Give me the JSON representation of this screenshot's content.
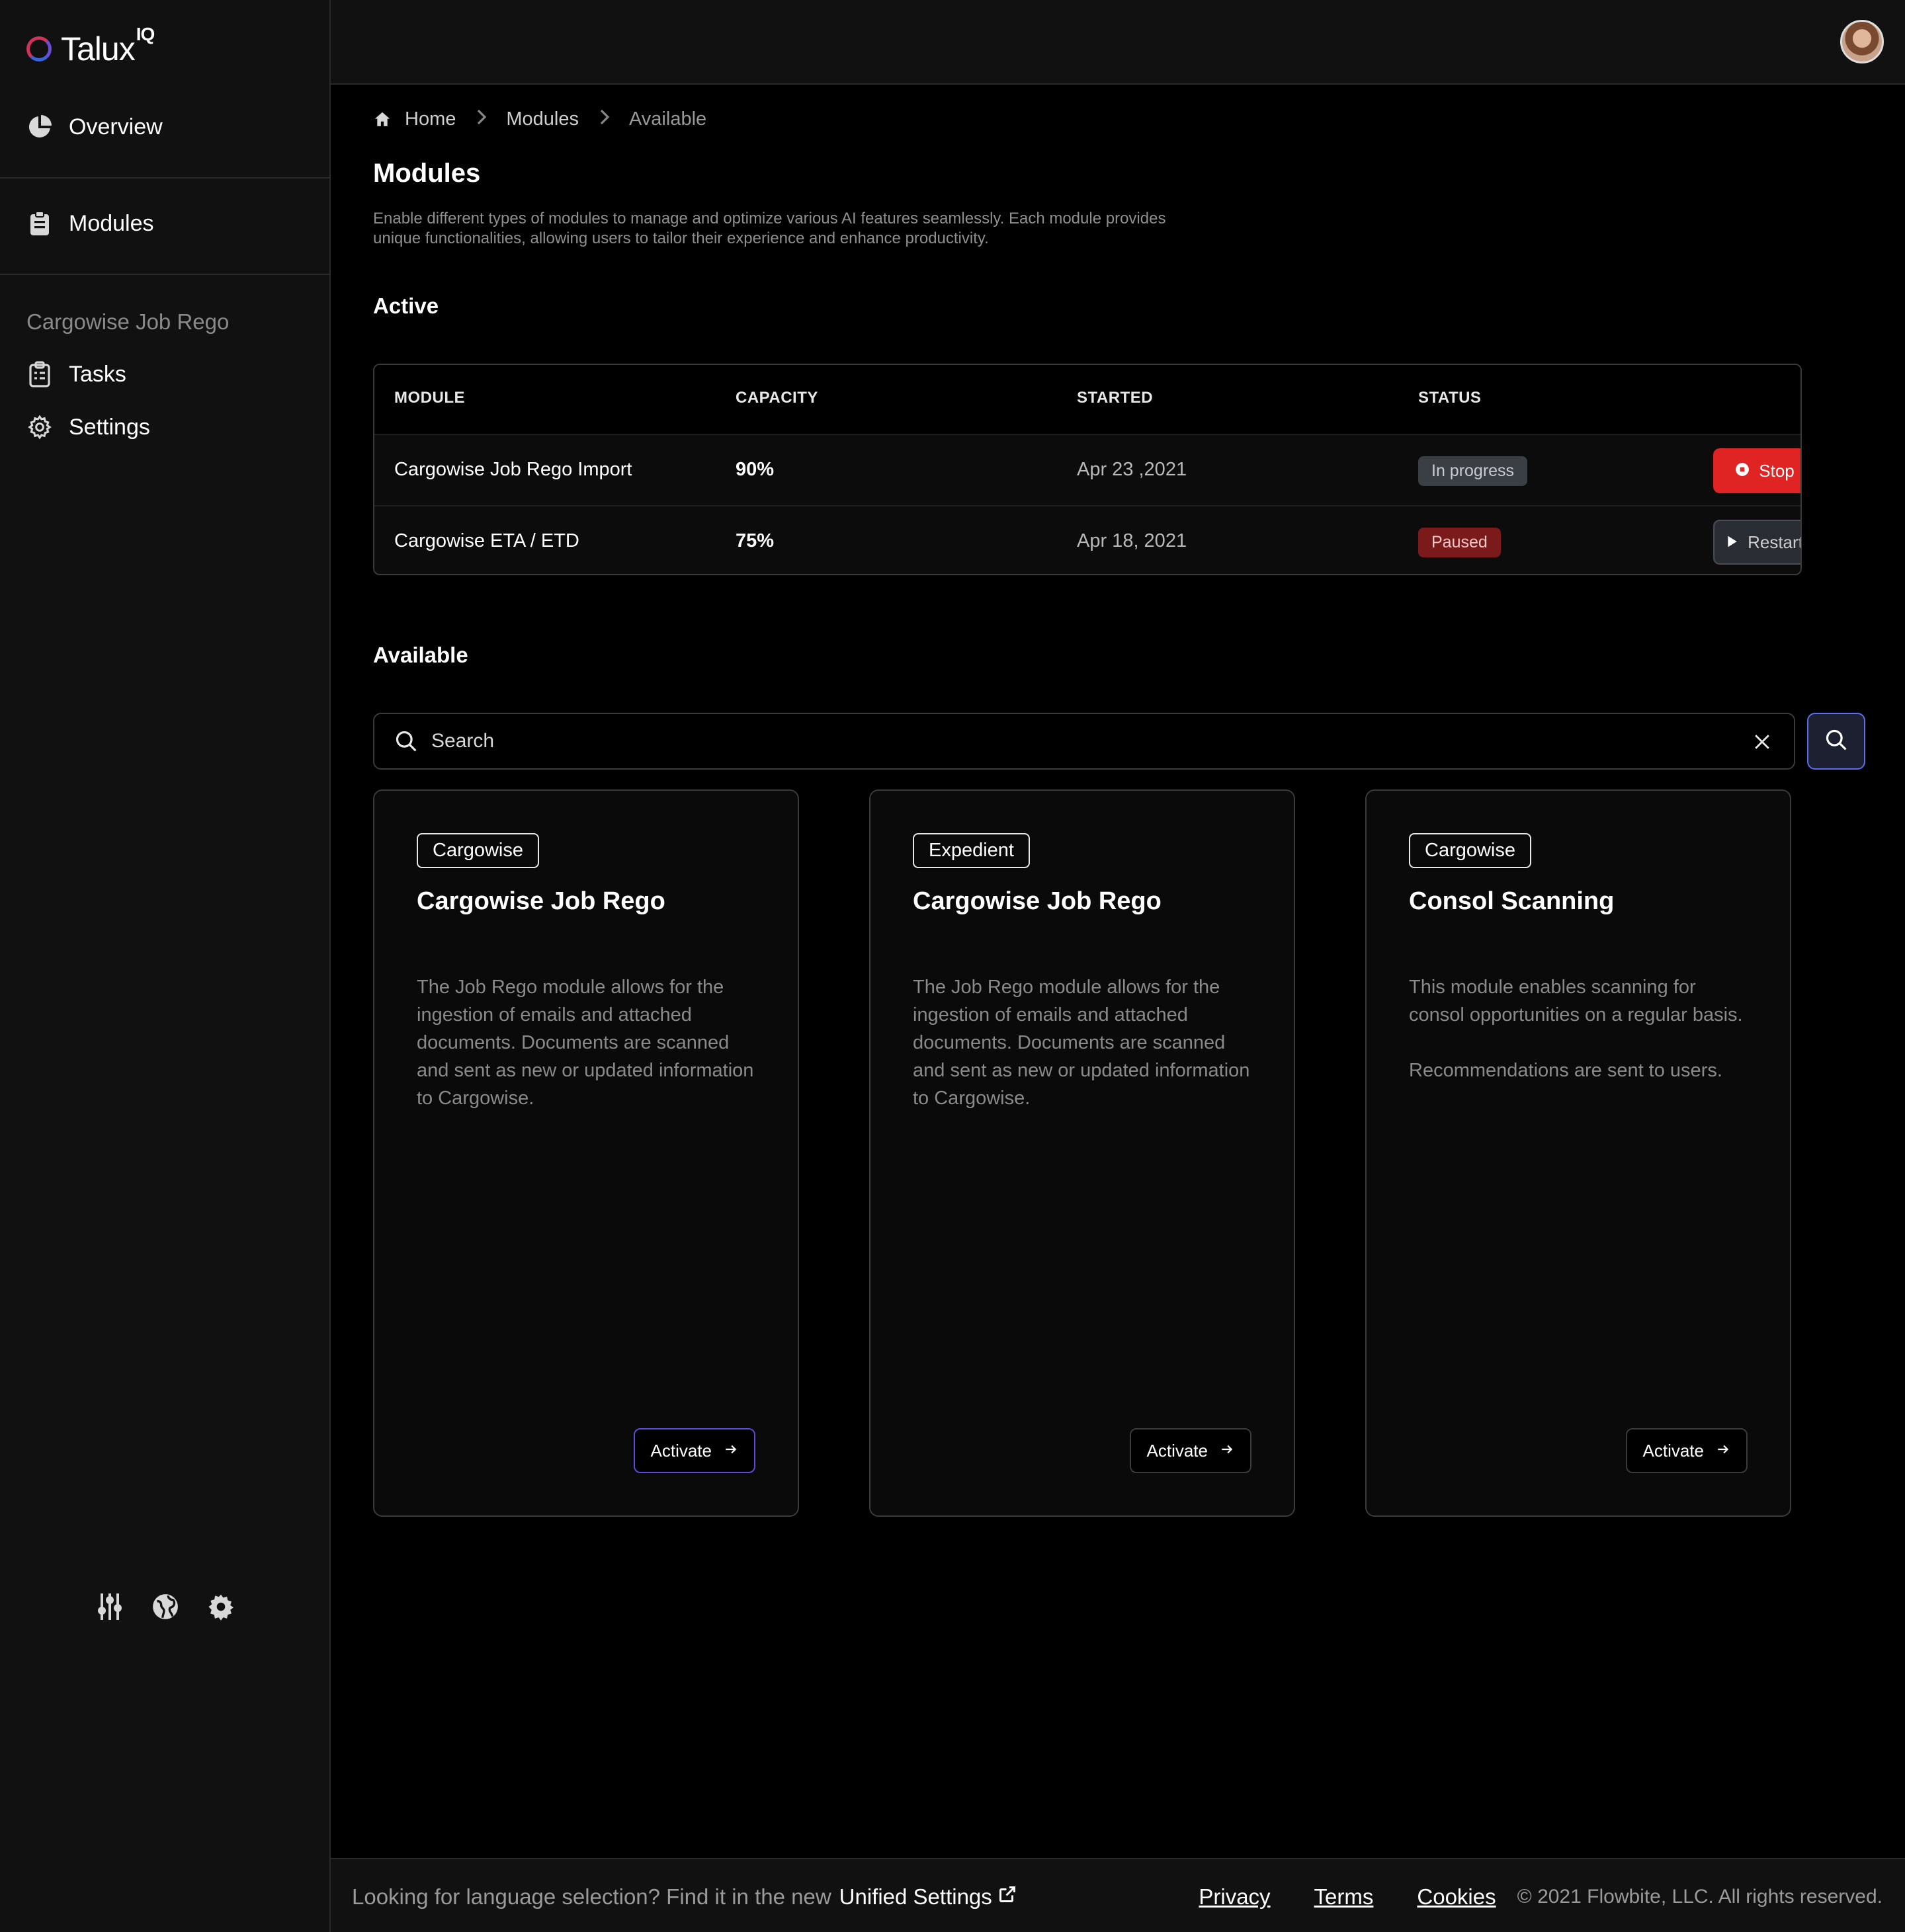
{
  "app": {
    "logo_text": "Talux",
    "logo_sup": "IQ"
  },
  "sidebar": {
    "overview_label": "Overview",
    "modules_label": "Modules",
    "group_title": "Cargowise Job Rego",
    "tasks_label": "Tasks",
    "settings_label": "Settings"
  },
  "breadcrumb": {
    "home": "Home",
    "modules": "Modules",
    "current": "Available"
  },
  "page": {
    "title": "Modules",
    "description": "Enable different types of modules to manage and optimize various AI features seamlessly. Each module provides unique functionalities, allowing users to tailor their experience and enhance productivity."
  },
  "active": {
    "title": "Active",
    "columns": [
      "MODULE",
      "CAPACITY",
      "STARTED",
      "STATUS"
    ],
    "rows": [
      {
        "module": "Cargowise Job Rego Import",
        "capacity": "90%",
        "started": "Apr 23 ,2021",
        "status": "In progress",
        "action": "Stop"
      },
      {
        "module": "Cargowise ETA / ETD",
        "capacity": "75%",
        "started": "Apr 18, 2021",
        "status": "Paused",
        "action": "Restart"
      }
    ]
  },
  "available": {
    "title": "Available",
    "search_placeholder": "Search",
    "cards": [
      {
        "tag": "Cargowise",
        "title": "Cargowise Job Rego",
        "desc": [
          "The Job Rego module allows for the ingestion of emails and attached documents. Documents are scanned and sent as new or updated information to Cargowise."
        ],
        "button": "Activate"
      },
      {
        "tag": "Expedient",
        "title": "Cargowise Job Rego",
        "desc": [
          "The Job Rego module allows for the ingestion of emails and attached documents. Documents are scanned and sent as new or updated information to Cargowise."
        ],
        "button": "Activate"
      },
      {
        "tag": "Cargowise",
        "title": "Consol Scanning",
        "desc": [
          "This module enables scanning for consol opportunities on a regular basis.",
          "Recommendations are sent to users."
        ],
        "button": "Activate"
      }
    ]
  },
  "footer": {
    "lang_text": "Looking for language selection? Find it in the new",
    "lang_link": "Unified Settings",
    "privacy": "Privacy",
    "terms": "Terms",
    "cookies": "Cookies",
    "copyright": "© 2021 Flowbite, LLC. All rights reserved."
  },
  "colors": {
    "danger": "#e02424",
    "paused_badge": "#7a1a1a",
    "accent": "#5b6df0"
  }
}
